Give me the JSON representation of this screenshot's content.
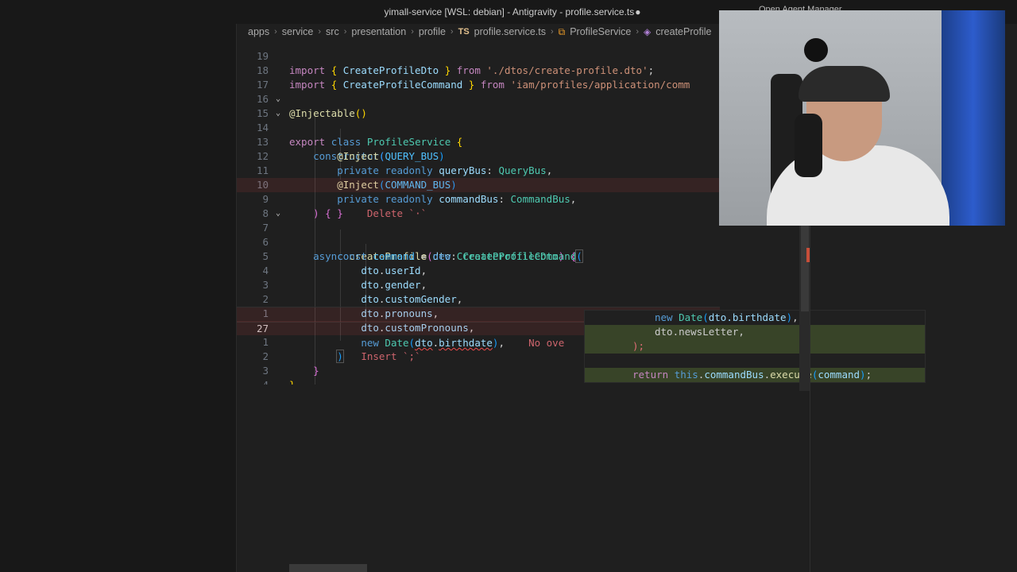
{
  "window": {
    "title": "yimall-service [WSL: debian] - Antigravity - profile.service.ts",
    "dirty_marker": "●"
  },
  "top_right": {
    "label": "Open Agent Manager"
  },
  "breadcrumb": {
    "items": [
      "apps",
      "service",
      "src",
      "presentation",
      "profile",
      "profile.service.ts",
      "ProfileService",
      "createProfile"
    ],
    "icons": [
      "typescript-icon",
      "class-icon",
      "method-icon"
    ]
  },
  "editor": {
    "lines": [
      {
        "num": "19",
        "code": "import { CreateProfileDto } from './dtos/create-profile.dto';"
      },
      {
        "num": "18",
        "code": "import { CreateProfileCommand } from 'iam/profiles/application/comm"
      },
      {
        "num": "17",
        "code": ""
      },
      {
        "num": "16",
        "code": "@Injectable()"
      },
      {
        "num": "15",
        "code": "export class ProfileService {"
      },
      {
        "num": "14",
        "code": "constructor("
      },
      {
        "num": "13",
        "code": "@Inject(QUERY_BUS)"
      },
      {
        "num": "12",
        "code": "private readonly queryBus: QueryBus,"
      },
      {
        "num": "11",
        "code": "@Inject(COMMAND_BUS)"
      },
      {
        "num": "10",
        "code": "private readonly commandBus: CommandBus,"
      },
      {
        "num": "9",
        "code": ") { }"
      },
      {
        "num": "8",
        "code": ""
      },
      {
        "num": "7",
        "code": "async createProfile(dto: CreateProfileDto) {"
      },
      {
        "num": "6",
        "code": "const command = new CreateProfileCommand("
      },
      {
        "num": "5",
        "code": "dto.userId,"
      },
      {
        "num": "4",
        "code": "dto.gender,"
      },
      {
        "num": "3",
        "code": "dto.customGender,"
      },
      {
        "num": "2",
        "code": "dto.pronouns,"
      },
      {
        "num": "1",
        "code": "dto.customPronouns,"
      },
      {
        "num": "27",
        "code": "new Date(dto.birthdate),"
      },
      {
        "num": "1",
        "code": ")"
      },
      {
        "num": "2",
        "code": "}"
      },
      {
        "num": "3",
        "code": "}"
      },
      {
        "num": "4",
        "code": ""
      }
    ],
    "ghost_delete": "Delete `·`",
    "ghost_insert": "Insert `;`",
    "ghost_overload": "No ove"
  },
  "suggestion": {
    "lines": [
      "new Date(dto.birthdate),",
      "dto.newsLetter,",
      ");",
      "",
      "return this.commandBus.execute(command);"
    ]
  }
}
